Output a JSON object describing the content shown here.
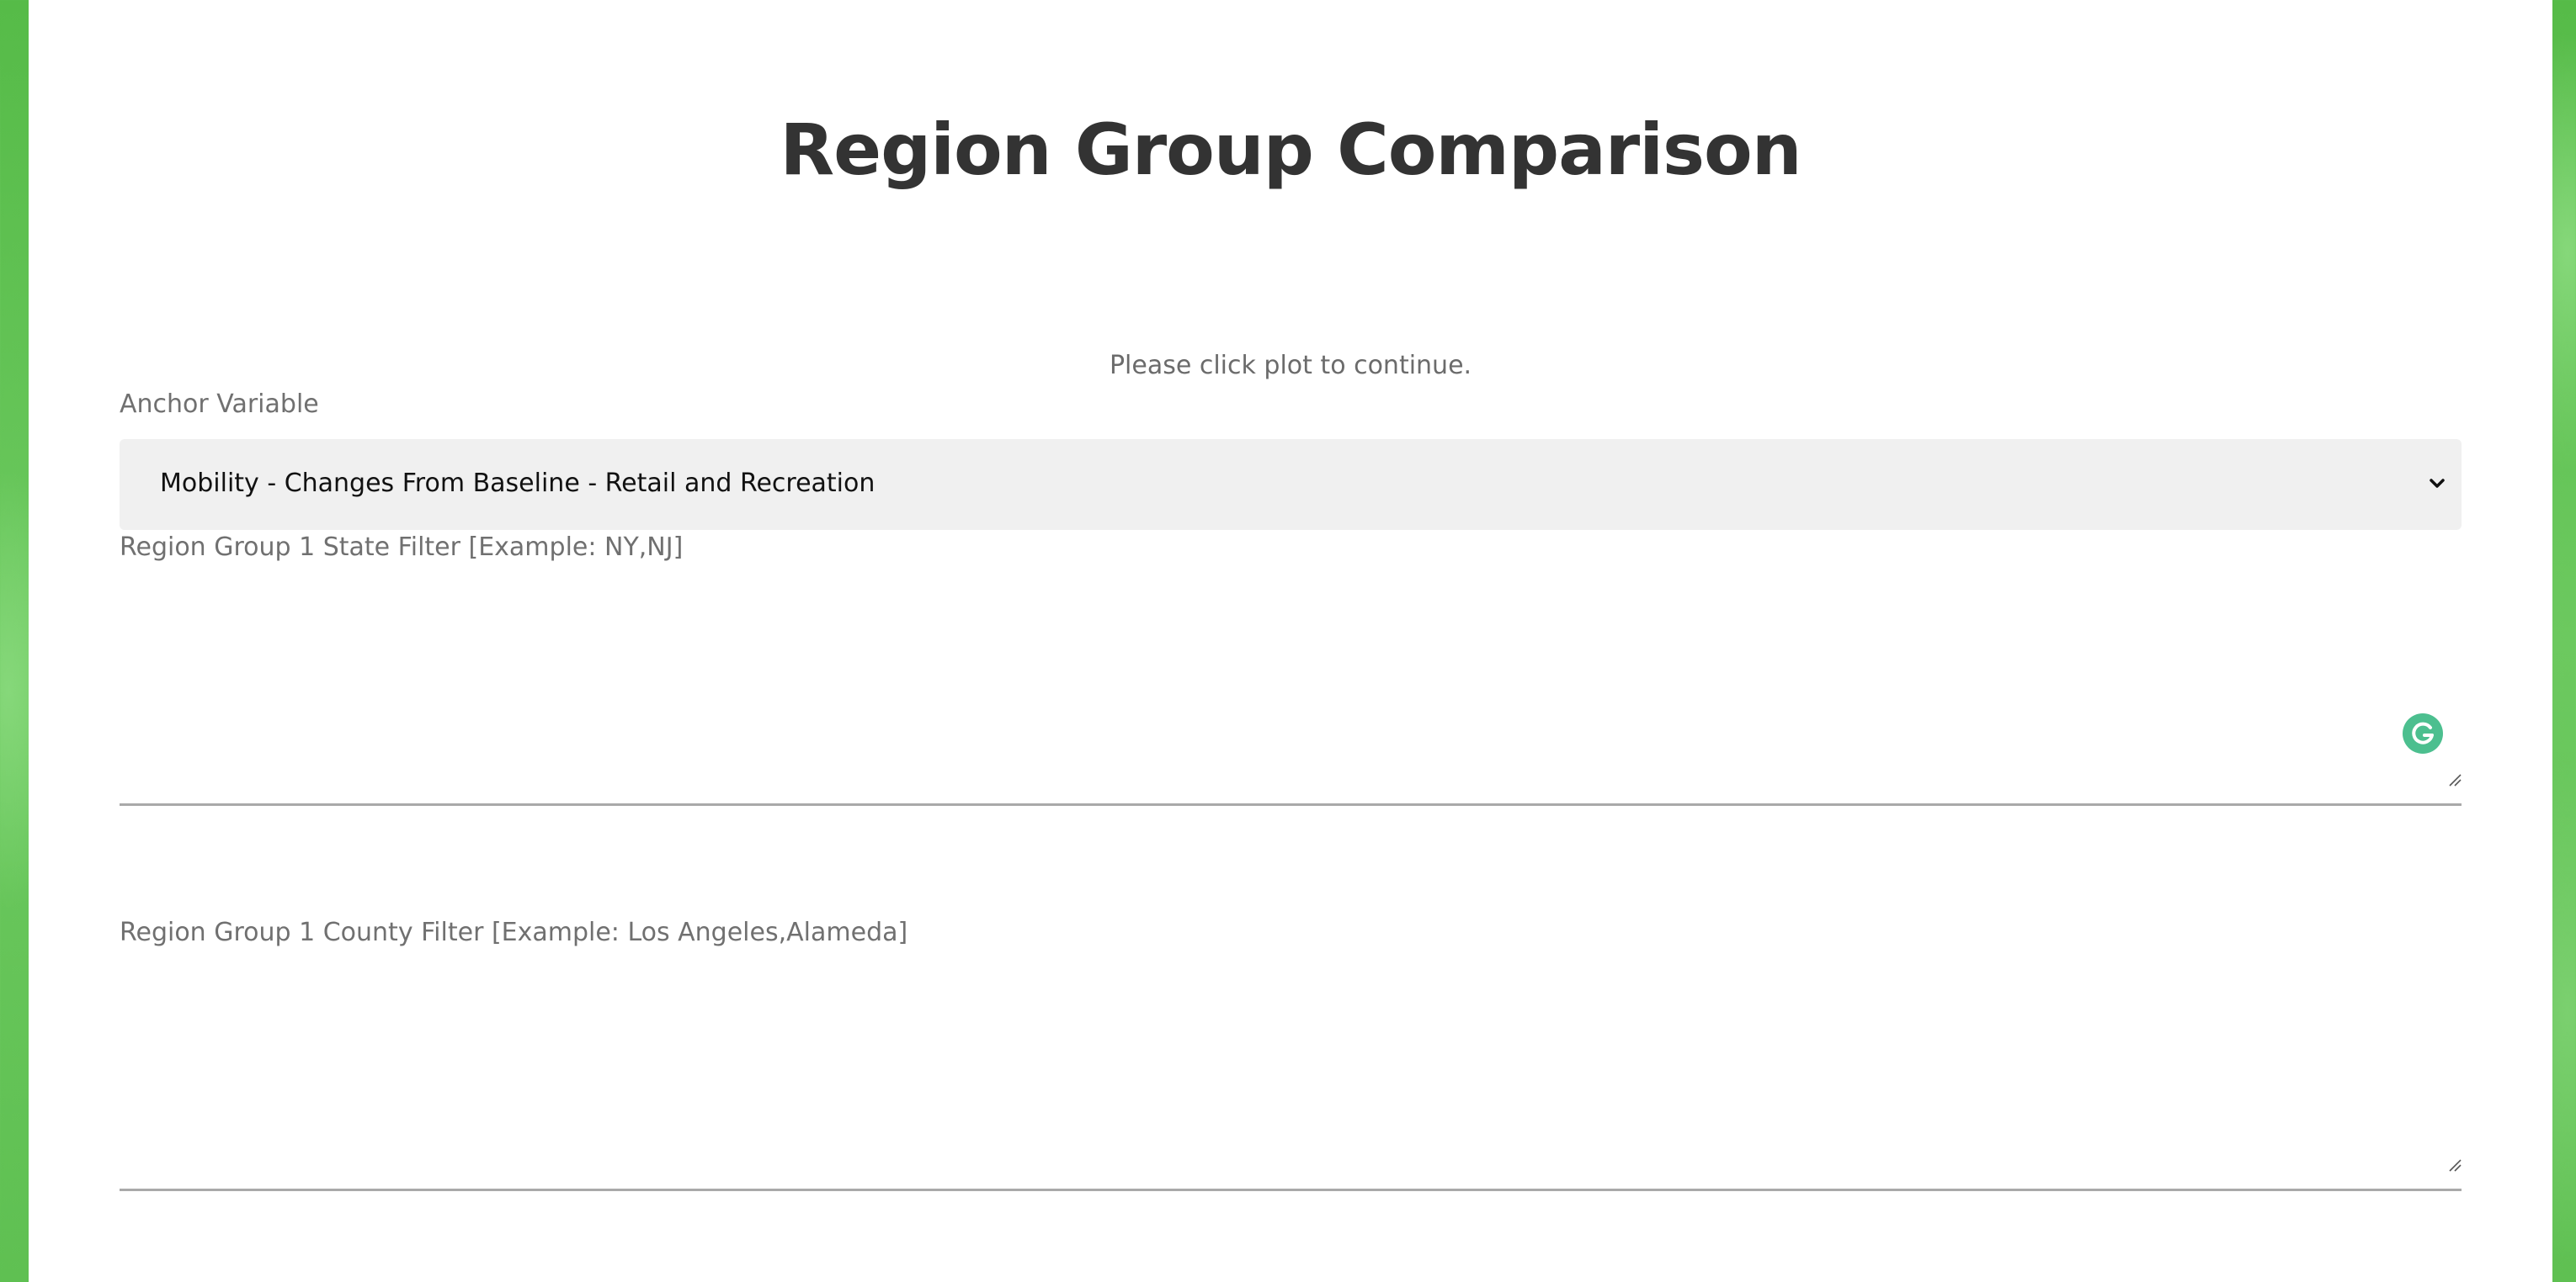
{
  "page": {
    "title": "Region Group Comparison",
    "notice": "Please click plot to continue."
  },
  "form": {
    "anchor_variable": {
      "label": "Anchor Variable",
      "selected": "Mobility - Changes From Baseline - Retail and Recreation"
    },
    "state_filter": {
      "label": "Region Group 1 State Filter [Example: NY,NJ]",
      "value": ""
    },
    "county_filter": {
      "label": "Region Group 1 County Filter [Example: Los Angeles,Alameda]",
      "value": ""
    }
  },
  "icons": {
    "select_arrow": "chevron-down-icon",
    "grammarly": "grammarly-icon",
    "resize": "resize-handle-icon"
  },
  "colors": {
    "background_green": "#5cc14e",
    "title_text": "#333333",
    "select_background": "#f0f0f0",
    "grammarly": "#4cbf8f"
  }
}
